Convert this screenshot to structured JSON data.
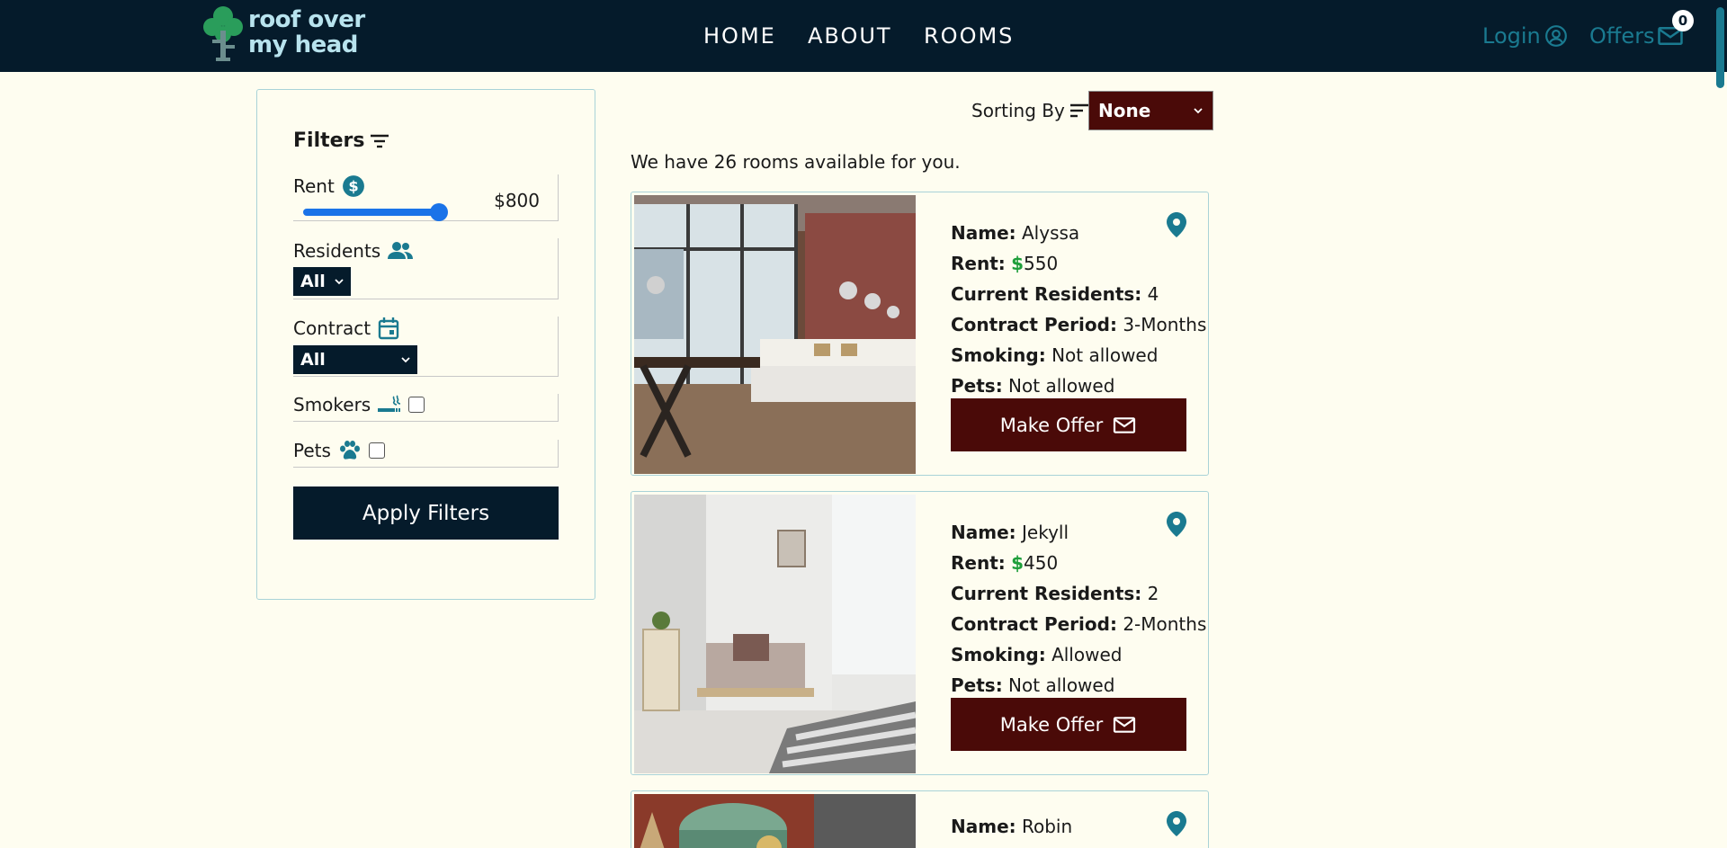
{
  "header": {
    "logo_line1": "roof over",
    "logo_line2": "my head",
    "nav": [
      "HOME",
      "ABOUT",
      "ROOMS"
    ],
    "login_label": "Login",
    "offers_label": "Offers",
    "offers_count": "0"
  },
  "filters": {
    "title": "Filters",
    "rent_label": "Rent",
    "rent_value": "$800",
    "rent_slider_fraction": 1.0,
    "residents_label": "Residents",
    "residents_selected": "All",
    "contract_label": "Contract",
    "contract_selected": "All",
    "smokers_label": "Smokers",
    "pets_label": "Pets",
    "apply_label": "Apply Filters"
  },
  "sorting": {
    "label": "Sorting By",
    "selected": "None"
  },
  "availability_text": "We have 26 rooms available for you.",
  "labels": {
    "name": "Name:",
    "rent": "Rent:",
    "residents": "Current Residents:",
    "contract": "Contract Period:",
    "smoking": "Smoking:",
    "pets": "Pets:",
    "make_offer": "Make Offer",
    "currency": "$"
  },
  "rooms": [
    {
      "name": "Alyssa",
      "rent": "550",
      "residents": "4",
      "contract": "3-Months",
      "smoking": "Not allowed",
      "pets": "Not allowed"
    },
    {
      "name": "Jekyll",
      "rent": "450",
      "residents": "2",
      "contract": "2-Months",
      "smoking": "Allowed",
      "pets": "Not allowed"
    },
    {
      "name": "Robin"
    }
  ],
  "colors": {
    "header_bg": "#051b2b",
    "accent_teal": "#1a7a90",
    "offer_button": "#4a0a08",
    "page_bg": "#fefdf0"
  }
}
